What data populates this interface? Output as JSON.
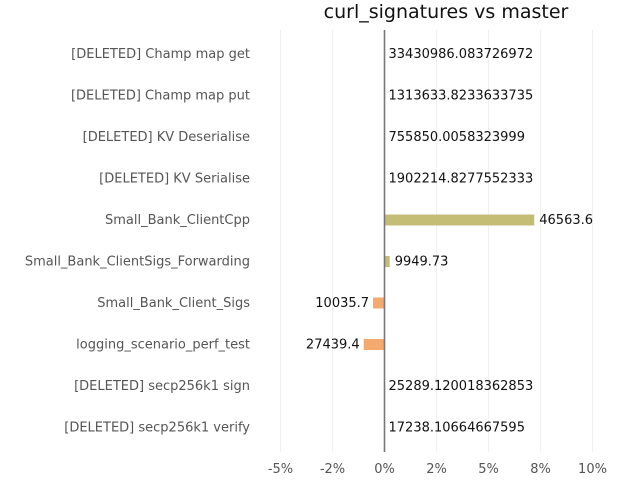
{
  "chart_data": {
    "type": "bar",
    "orientation": "horizontal",
    "title": "curl_signatures vs master",
    "xlabel": "",
    "ylabel": "",
    "xlim": [
      -6,
      11
    ],
    "x_ticks": [
      -5,
      -2.5,
      0,
      2.5,
      5,
      7.5,
      10
    ],
    "x_tick_labels": [
      "-5%",
      "-2%",
      "0%",
      "2%",
      "5%",
      "8%",
      "10%"
    ],
    "grid": true,
    "categories": [
      "[DELETED] Champ map get",
      "[DELETED] Champ map put",
      "[DELETED] KV Deserialise",
      "[DELETED] KV Serialise",
      "Small_Bank_ClientCpp",
      "Small_Bank_ClientSigs_Forwarding",
      "Small_Bank_Client_Sigs",
      "logging_scenario_perf_test",
      "[DELETED] secp256k1 sign",
      "[DELETED] secp256k1 verify"
    ],
    "values": [
      null,
      null,
      null,
      null,
      7.2,
      0.25,
      -0.55,
      -1.0,
      null,
      null
    ],
    "value_labels": [
      "33430986.083726972",
      "1313633.8233633735",
      "755850.0058323999",
      "1902214.8277552333",
      "46563.6",
      "9949.73",
      "10035.7",
      "27439.4",
      "25289.120018362853",
      "17238.10664667595"
    ],
    "colors": {
      "positive": "#c3bd75",
      "negative": "#f4aa6e",
      "zero_line": "#777777",
      "grid": "#f0f0f0",
      "tick_text": "#555555",
      "label_text": "#111111"
    }
  }
}
